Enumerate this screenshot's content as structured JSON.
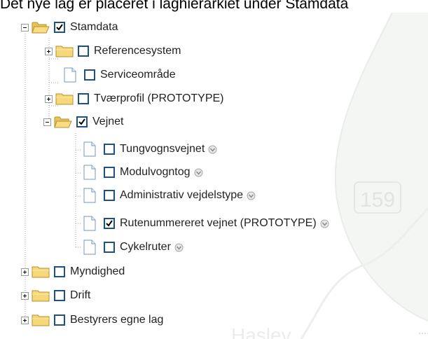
{
  "caption": "Det nye lag er placeret i laghierarkiet under Stamdata",
  "map": {
    "badge_text": "159",
    "faint_text": "Haslev"
  },
  "colors": {
    "checkbox_border": "#1c5180",
    "folder_fill": "#f6d77a",
    "tree_line": "#a0a0a0"
  },
  "tree": [
    {
      "label": "Stamdata",
      "checked": true,
      "expander": "minus",
      "icon": "folder-open-icon"
    },
    {
      "label": "Referencesystem",
      "checked": false,
      "expander": "plus",
      "icon": "folder-icon"
    },
    {
      "label": "Serviceområde",
      "checked": false,
      "expander": "none",
      "icon": "document-icon"
    },
    {
      "label": "Tværprofil (PROTOTYPE)",
      "checked": false,
      "expander": "plus",
      "icon": "folder-icon"
    },
    {
      "label": "Vejnet",
      "checked": true,
      "expander": "minus",
      "icon": "folder-open-icon"
    },
    {
      "label": "Tungvognsvejnet",
      "checked": false,
      "expander": "none",
      "icon": "document-icon",
      "info": true
    },
    {
      "label": "Modulvogntog",
      "checked": false,
      "expander": "none",
      "icon": "document-icon",
      "info": true
    },
    {
      "label": "Administrativ vejdelstype",
      "checked": false,
      "expander": "none",
      "icon": "document-icon",
      "info": true
    },
    {
      "label": "Rutenummereret vejnet (PROTOTYPE)",
      "checked": true,
      "expander": "none",
      "icon": "document-icon",
      "info": true
    },
    {
      "label": "Cykelruter",
      "checked": false,
      "expander": "none",
      "icon": "document-icon",
      "info": true
    },
    {
      "label": "Myndighed",
      "checked": false,
      "expander": "plus",
      "icon": "folder-icon"
    },
    {
      "label": "Drift",
      "checked": false,
      "expander": "plus",
      "icon": "folder-icon"
    },
    {
      "label": "Bestyrers egne lag",
      "checked": false,
      "expander": "plus",
      "icon": "folder-icon"
    }
  ]
}
